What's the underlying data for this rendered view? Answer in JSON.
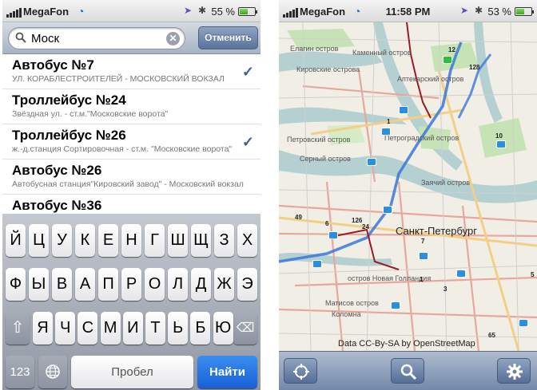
{
  "left_screen": {
    "status": {
      "carrier": "MegaFon",
      "battery_pct": "55 %"
    },
    "search": {
      "value": "Моск",
      "cancel_label": "Отменить"
    },
    "results": [
      {
        "title": "Автобус №7",
        "subtitle": "УЛ. КОРАБЛЕСТРОИТЕЛЕЙ - МОСКОВСКИЙ ВОКЗАЛ",
        "checked": true
      },
      {
        "title": "Троллейбус №24",
        "subtitle": "Звёздная ул. - ст.м.\"Московские ворота\"",
        "checked": false
      },
      {
        "title": "Троллейбус №26",
        "subtitle": "ж.-д.станция Сортировочная - ст.м. \"Московские ворота\"",
        "checked": true
      },
      {
        "title": "Автобус №26",
        "subtitle": "Автобусная станция\"Кировский завод\" - Московский вокзал",
        "checked": false
      },
      {
        "title": "Автобус №36",
        "subtitle": "",
        "checked": false
      }
    ],
    "keyboard": {
      "row1": [
        "Й",
        "Ц",
        "У",
        "К",
        "Е",
        "Н",
        "Г",
        "Ш",
        "Щ",
        "З",
        "Х"
      ],
      "row2": [
        "Ф",
        "Ы",
        "В",
        "А",
        "П",
        "Р",
        "О",
        "Л",
        "Д",
        "Ж",
        "Э"
      ],
      "row3": [
        "Я",
        "Ч",
        "С",
        "М",
        "И",
        "Т",
        "Ь",
        "Б",
        "Ю"
      ],
      "numbers_label": "123",
      "space_label": "Пробел",
      "go_label": "Найти"
    }
  },
  "right_screen": {
    "status": {
      "carrier": "MegaFon",
      "time": "11:58 PM",
      "battery_pct": "53 %"
    },
    "map": {
      "city": "Санкт-Петербург",
      "labels": [
        "Елагин остров",
        "Каменный остров",
        "Кировские острова",
        "Аптекарский остров",
        "Петровский остров",
        "Петроградский остров",
        "Серный остров",
        "Заячий остров",
        "остров Новая Голландия",
        "Матисов остров",
        "Коломна"
      ],
      "route_numbers": [
        "12",
        "128",
        "1",
        "126",
        "24",
        "6",
        "10",
        "7",
        "65",
        "5",
        "3",
        "1",
        "49"
      ],
      "attribution": "Data CC-By-SA by OpenStreetMap"
    },
    "toolbar": {
      "locate": "crosshair-icon",
      "search": "search-icon",
      "settings": "gear-icon"
    }
  }
}
